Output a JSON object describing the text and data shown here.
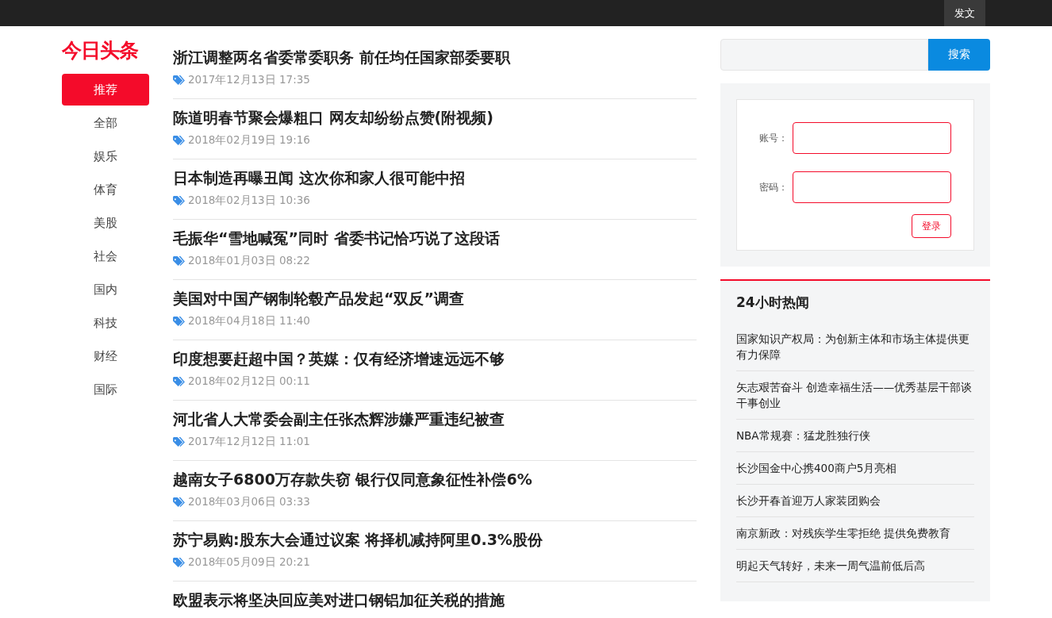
{
  "topbar": {
    "button": "发文"
  },
  "logo": "今日头条",
  "channels": [
    {
      "label": "推荐",
      "selected": true
    },
    {
      "label": "全部",
      "selected": false
    },
    {
      "label": "娱乐",
      "selected": false
    },
    {
      "label": "体育",
      "selected": false
    },
    {
      "label": "美股",
      "selected": false
    },
    {
      "label": "社会",
      "selected": false
    },
    {
      "label": "国内",
      "selected": false
    },
    {
      "label": "科技",
      "selected": false
    },
    {
      "label": "财经",
      "selected": false
    },
    {
      "label": "国际",
      "selected": false
    }
  ],
  "articles": [
    {
      "title": "浙江调整两名省委常委职务 前任均任国家部委要职",
      "date": "2017年12月13日 17:35"
    },
    {
      "title": "陈道明春节聚会爆粗口 网友却纷纷点赞(附视频)",
      "date": "2018年02月19日 19:16"
    },
    {
      "title": "日本制造再曝丑闻 这次你和家人很可能中招",
      "date": "2018年02月13日 10:36"
    },
    {
      "title": "毛振华“雪地喊冤”同时 省委书记恰巧说了这段话",
      "date": "2018年01月03日 08:22"
    },
    {
      "title": "美国对中国产钢制轮毂产品发起“双反”调查",
      "date": "2018年04月18日 11:40"
    },
    {
      "title": "印度想要赶超中国？英媒：仅有经济增速远远不够",
      "date": "2018年02月12日 00:11"
    },
    {
      "title": "河北省人大常委会副主任张杰辉涉嫌严重违纪被查",
      "date": "2017年12月12日 11:01"
    },
    {
      "title": "越南女子6800万存款失窃 银行仅同意象征性补偿6%",
      "date": "2018年03月06日 03:33"
    },
    {
      "title": "苏宁易购:股东大会通过议案 将择机减持阿里0.3%股份",
      "date": "2018年05月09日 20:21"
    },
    {
      "title": "欧盟表示将坚决回应美对进口钢铝加征关税的措施"
    }
  ],
  "search": {
    "button": "搜索"
  },
  "login": {
    "account_label": "账号：",
    "password_label": "密码：",
    "button": "登录"
  },
  "hot": {
    "title": "24小时热闻",
    "items": [
      "国家知识产权局：为创新主体和市场主体提供更有力保障",
      "矢志艰苦奋斗 创造幸福生活——优秀基层干部谈干事创业",
      "NBA常规赛：猛龙胜独行侠",
      "长沙国金中心携400商户5月亮相",
      "长沙开春首迎万人家装团购会",
      "南京新政：对残疾学生零拒绝 提供免费教育",
      "明起天气转好，未来一周气温前低后高"
    ]
  }
}
